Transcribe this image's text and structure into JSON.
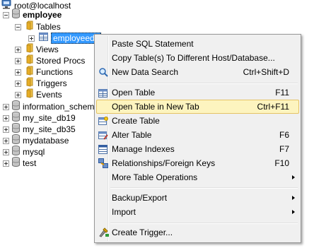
{
  "tree": {
    "connection": "root@localhost",
    "database": "employee",
    "tables_folder": "Tables",
    "selected_table": "employeede",
    "subfolders": [
      "Views",
      "Stored Procs",
      "Functions",
      "Triggers",
      "Events"
    ],
    "databases": [
      "information_schema",
      "my_site_db19",
      "my_site_db35",
      "mydatabase",
      "mysql",
      "test"
    ]
  },
  "context_menu": {
    "items": {
      "paste_sql": "Paste SQL Statement",
      "copy_table": "Copy Table(s) To Different Host/Database...",
      "new_search": "New Data Search",
      "new_search_shortcut": "Ctrl+Shift+D",
      "open_table": "Open Table",
      "open_table_shortcut": "F11",
      "open_new_tab": "Open Table in New Tab",
      "open_new_tab_shortcut": "Ctrl+F11",
      "create_table": "Create Table",
      "alter_table": "Alter Table",
      "alter_table_shortcut": "F6",
      "manage_indexes": "Manage Indexes",
      "manage_indexes_shortcut": "F7",
      "relationships": "Relationships/Foreign Keys",
      "relationships_shortcut": "F10",
      "more_ops": "More Table Operations",
      "backup_export": "Backup/Export",
      "import": "Import",
      "create_trigger": "Create Trigger..."
    }
  },
  "icons": {
    "connection": "server-icon",
    "database": "database-icon",
    "folder": "folder-icon",
    "table": "table-icon"
  },
  "colors": {
    "selection": "#3399ff",
    "menu_hover": "#fdf4bf",
    "menu_hover_border": "#e5c365",
    "menu_background": "#f0f0f0"
  }
}
